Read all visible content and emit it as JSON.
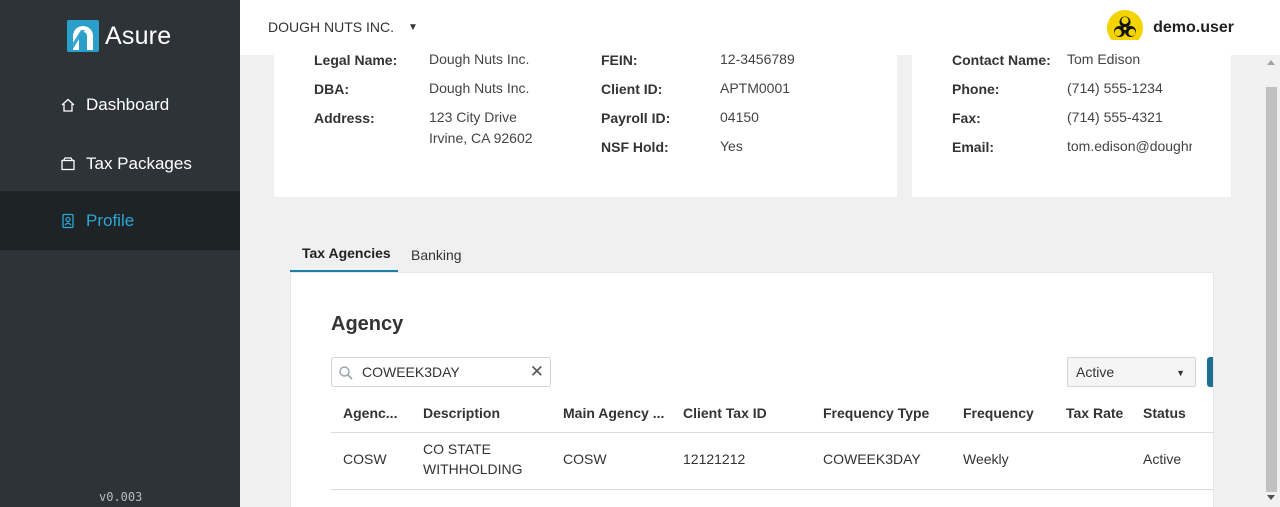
{
  "app": {
    "name": "Asure",
    "version": "v0.003"
  },
  "sidebar": {
    "items": [
      {
        "label": "Dashboard",
        "icon": "home-icon"
      },
      {
        "label": "Tax Packages",
        "icon": "package-icon"
      },
      {
        "label": "Profile",
        "icon": "profile-icon",
        "active": true
      }
    ]
  },
  "header": {
    "company": "DOUGH NUTS INC.",
    "username": "demo.user",
    "avatar_icon": "biohazard-icon"
  },
  "client_info": {
    "legal_name_label": "Legal Name:",
    "legal_name": "Dough Nuts Inc.",
    "dba_label": "DBA:",
    "dba": "Dough Nuts Inc.",
    "address_label": "Address:",
    "address_line1": "123 City Drive",
    "address_line2": "Irvine, CA 92602",
    "fein_label": "FEIN:",
    "fein": "12-3456789",
    "client_id_label": "Client ID:",
    "client_id": "APTM0001",
    "payroll_id_label": "Payroll ID:",
    "payroll_id": "04150",
    "nsf_hold_label": "NSF Hold:",
    "nsf_hold": "Yes"
  },
  "contact": {
    "name_label": "Contact Name:",
    "name": "Tom Edison",
    "phone_label": "Phone:",
    "phone": "(714) 555-1234",
    "fax_label": "Fax:",
    "fax": "(714) 555-4321",
    "email_label": "Email:",
    "email": "tom.edison@doughnuts.com"
  },
  "tabs": [
    {
      "label": "Tax Agencies",
      "active": true
    },
    {
      "label": "Banking"
    }
  ],
  "agency": {
    "title": "Agency",
    "search_value": "COWEEK3DAY",
    "status_filter": "Active",
    "columns": [
      "Agenc...",
      "Description",
      "Main Agency ...",
      "Client Tax ID",
      "Frequency Type",
      "Frequency",
      "Tax Rate",
      "Status"
    ],
    "rows": [
      {
        "agency": "COSW",
        "description_line1": "CO STATE",
        "description_line2": "WITHHOLDING",
        "main_agency": "COSW",
        "client_tax_id": "12121212",
        "frequency_type": "COWEEK3DAY",
        "frequency": "Weekly",
        "tax_rate": "",
        "status": "Active"
      }
    ]
  },
  "colors": {
    "sidebar_bg": "#2d3337",
    "active_nav_bg": "#1e2326",
    "accent": "#2aa7d4",
    "tab_underline": "#1d7fa6",
    "avatar_bg": "#f4d400"
  }
}
